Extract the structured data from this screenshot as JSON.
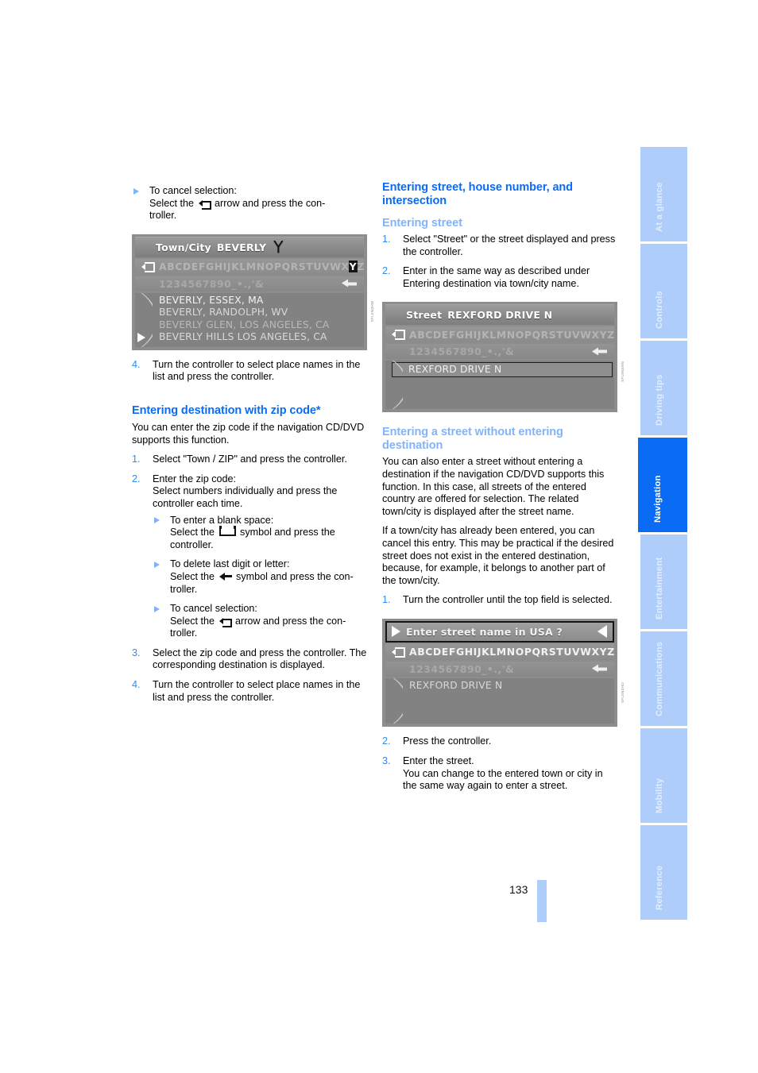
{
  "page": {
    "number": "133",
    "chapter": "Navigation"
  },
  "sidebar": {
    "tabs": [
      {
        "label": "At a glance",
        "active": false
      },
      {
        "label": "Controls",
        "active": false
      },
      {
        "label": "Driving tips",
        "active": false
      },
      {
        "label": "Navigation",
        "active": true
      },
      {
        "label": "Entertainment",
        "active": false
      },
      {
        "label": "Communications",
        "active": false
      },
      {
        "label": "Mobility",
        "active": false
      },
      {
        "label": "Reference",
        "active": false
      }
    ],
    "active_color": "#0a6bf5",
    "inactive_color": "#aecdfb"
  },
  "left_column": {
    "cancel_bullet": {
      "line1": "To cancel selection:",
      "line2_before": "Select the",
      "line2_after": "arrow and press the con-",
      "line3": "troller."
    },
    "figure_towncity": {
      "title_label": "Town/City",
      "title_value": "BEVERLY",
      "big_char": "Y",
      "alphabet": "ABCDEFGHIJKLMNOPQRSTUVWX",
      "alphabet_highlight": "Y",
      "alphabet_tail": "Z",
      "numbers": "1234567890_•.,'&",
      "list": [
        "BEVERLY, ESSEX, MA",
        "BEVERLY, RANDOLPH, WV",
        "BEVERLY GLEN, LOS ANGELES, CA",
        "BEVERLY HILLS LOS ANGELES, CA"
      ]
    },
    "step4_after_figure": {
      "num": "4.",
      "text": "Turn the controller to select place names in the list and press the controller."
    },
    "zip_heading": "Entering destination with zip code*",
    "zip_intro": "You can enter the zip code if the navigation CD/DVD supports this function.",
    "zip_steps": [
      {
        "num": "1.",
        "text": "Select \"Town / ZIP\" and press the controller."
      },
      {
        "num": "2.",
        "text": "Enter the zip code:\nSelect numbers individually and press the controller each time."
      },
      {
        "num": "3.",
        "text": "Select the zip code and press the controller. The corresponding destination is displayed."
      },
      {
        "num": "4.",
        "text": "Turn the controller to select place names in the list and press the controller."
      }
    ],
    "zip_substeps": [
      {
        "line1": "To enter a blank space:",
        "before": "Select the",
        "after": "symbol and press the",
        "line3": "controller."
      },
      {
        "line1": "To delete last digit or letter:",
        "before": "Select the",
        "after": "symbol and press the con-",
        "line3": "troller."
      },
      {
        "line1": "To cancel selection:",
        "before": "Select the",
        "after": "arrow and press the con-",
        "line3": "troller."
      }
    ]
  },
  "right_column": {
    "main_heading": "Entering street, house number, and intersection",
    "street_subheading": "Entering street",
    "street_steps": [
      {
        "num": "1.",
        "text": "Select \"Street\" or the street displayed and press the controller."
      },
      {
        "num": "2.",
        "text": "Enter in the same way as described under Entering destination via town/city name."
      }
    ],
    "figure_street": {
      "title_label": "Street",
      "title_value": "REXFORD DRIVE N",
      "alphabet": "ABCDEFGHIJKLMNOPQRSTUVWXYZ",
      "numbers": "1234567890_•.,'&",
      "selected_item": "REXFORD DRIVE N"
    },
    "nodest_subheading": "Entering a street without entering destination",
    "nodest_para1": "You can also enter a street without entering a destination if the navigation CD/DVD supports this function. In this case, all streets of the entered country are offered for selection. The related town/city is displayed after the street name.",
    "nodest_para2": "If a town/city has already been entered, you can cancel this entry. This may be practical if the desired street does not exist in the entered destination, because, for example, it belongs to another part of the town/city.",
    "nodest_step1": {
      "num": "1.",
      "text": "Turn the controller until the top field is selected."
    },
    "figure_enter_street": {
      "prompt": "Enter street name in USA ?",
      "alphabet": "ABCDEFGHIJKLMNOPQRSTUVWXYZ",
      "numbers": "1234567890_•.,'&",
      "list_item": "REXFORD DRIVE N"
    },
    "nodest_steps_after": [
      {
        "num": "2.",
        "text": "Press the controller."
      },
      {
        "num": "3.",
        "text": "Enter the street.\nYou can change to the entered town or city in the same way again to enter a street."
      }
    ]
  }
}
